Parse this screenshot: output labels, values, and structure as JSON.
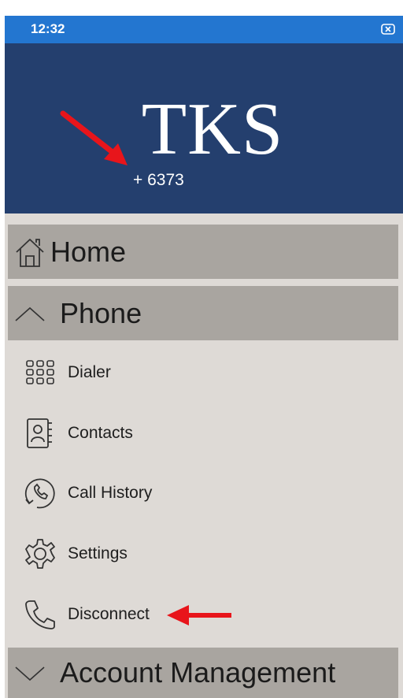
{
  "status_bar": {
    "time": "12:32",
    "icon": "close-box-icon"
  },
  "header": {
    "logo_text": "TKS",
    "phone_number": "+ 6373"
  },
  "menu": {
    "home": {
      "label": "Home",
      "icon": "home-icon"
    },
    "phone": {
      "label": "Phone",
      "icon": "chevron-up-icon"
    },
    "items": [
      {
        "label": "Dialer",
        "icon": "dialpad-icon"
      },
      {
        "label": "Contacts",
        "icon": "contacts-book-icon"
      },
      {
        "label": "Call History",
        "icon": "call-history-icon"
      },
      {
        "label": "Settings",
        "icon": "gear-icon"
      },
      {
        "label": "Disconnect",
        "icon": "phone-handset-icon"
      }
    ],
    "account": {
      "label": "Account Management",
      "icon": "chevron-down-icon"
    }
  },
  "colors": {
    "status_bar": "#2376d0",
    "header": "#243f6e",
    "menu_background": "#dedad6",
    "section_background": "#a9a5a0",
    "annotation_arrow": "#e8151b"
  }
}
